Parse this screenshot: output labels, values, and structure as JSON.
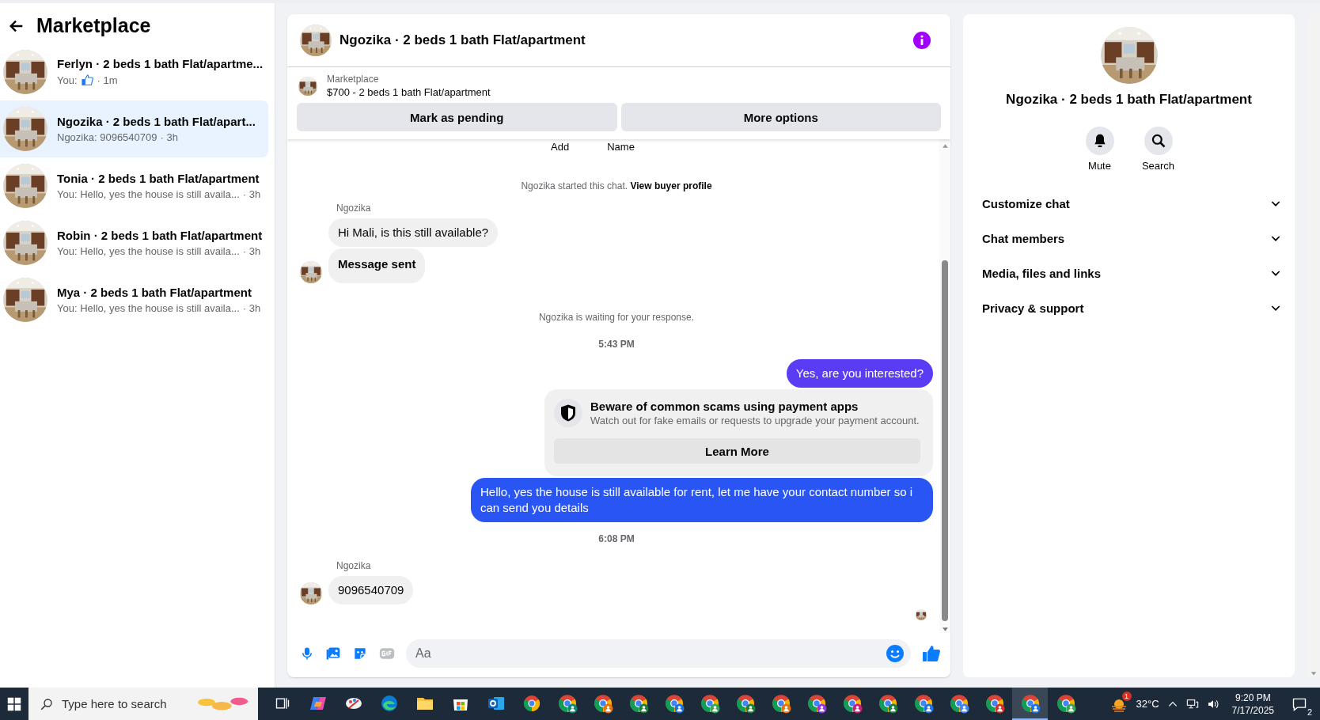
{
  "sidebar": {
    "title": "Marketplace",
    "conversations": [
      {
        "title": "Ferlyn · 2 beds 1 bath Flat/apartme...",
        "kind": "like",
        "preview": "You:",
        "time": "· 1m",
        "selected": false
      },
      {
        "title": "Ngozika · 2 beds 1 bath Flat/apart...",
        "kind": "text",
        "preview": "Ngozika: 9096540709",
        "time": "· 3h",
        "selected": true
      },
      {
        "title": "Tonia · 2 beds 1 bath Flat/apartment",
        "kind": "text",
        "preview": "You: Hello, yes the house is still availa...",
        "time": "· 3h",
        "selected": false
      },
      {
        "title": "Robin · 2 beds 1 bath Flat/apartment",
        "kind": "text",
        "preview": "You: Hello, yes the house is still availa...",
        "time": "· 3h",
        "selected": false
      },
      {
        "title": "Mya · 2 beds 1 bath Flat/apartment",
        "kind": "text",
        "preview": "You: Hello, yes the house is still availa...",
        "time": "· 3h",
        "selected": false
      }
    ]
  },
  "chat": {
    "title": "Ngozika · 2 beds 1 bath Flat/apartment",
    "listing": {
      "label": "Marketplace",
      "title": "$700 - 2 beds 1 bath Flat/apartment",
      "buttons": [
        "Mark as pending",
        "More options"
      ]
    },
    "messages": [
      {
        "kind": "cutoff",
        "texts": [
          "Add",
          "Name"
        ]
      },
      {
        "kind": "notice",
        "text": "Ngozika started this chat.",
        "link": "View buyer profile"
      },
      {
        "kind": "sender",
        "text": "Ngozika"
      },
      {
        "kind": "incoming",
        "text": "Hi Mali, is this still available?",
        "bold": false,
        "avatar": false
      },
      {
        "kind": "incoming",
        "text": "Message sent",
        "bold": true,
        "avatar": true
      },
      {
        "kind": "notice",
        "text": "Ngozika is waiting for your response."
      },
      {
        "kind": "timestamp",
        "text": "5:43 PM"
      },
      {
        "kind": "outgoing",
        "text": "Yes, are you interested?",
        "color": "#5b3cf5"
      },
      {
        "kind": "warning",
        "title": "Beware of common scams using payment apps",
        "text": "Watch out for fake emails or requests to upgrade your payment account.",
        "button": "Learn More"
      },
      {
        "kind": "outgoing",
        "text": "Hello, yes the house is still available for rent, let me have your contact number so i can send you details",
        "color": "#2a55f5"
      },
      {
        "kind": "timestamp",
        "text": "6:08 PM"
      },
      {
        "kind": "sender",
        "text": "Ngozika"
      },
      {
        "kind": "incoming",
        "text": "9096540709",
        "bold": false,
        "avatar": true
      },
      {
        "kind": "seen"
      }
    ],
    "composer": {
      "placeholder": "Aa"
    }
  },
  "info": {
    "title": "Ngozika · 2 beds 1 bath Flat/apartment",
    "actions": [
      {
        "kind": "bell",
        "label": "Mute"
      },
      {
        "kind": "search",
        "label": "Search"
      }
    ],
    "sections": [
      {
        "label": "Customize chat",
        "expanded": false
      },
      {
        "label": "Chat members",
        "expanded": false
      },
      {
        "label": "Media, files and links",
        "expanded": false
      },
      {
        "label": "Privacy & support",
        "expanded": false
      }
    ]
  },
  "taskbar": {
    "search_placeholder": "Type here to search",
    "apps": [
      {
        "kind": "task-view",
        "active": false
      },
      {
        "kind": "copilot",
        "active": false
      },
      {
        "kind": "paint",
        "active": false
      },
      {
        "kind": "edge",
        "active": false
      },
      {
        "kind": "folder",
        "active": false
      },
      {
        "kind": "store",
        "active": false
      },
      {
        "kind": "outlook",
        "active": false
      },
      {
        "kind": "chrome",
        "active": false
      },
      {
        "kind": "chrome-profile",
        "color": "#0b8a73",
        "active": false
      },
      {
        "kind": "chrome-profile",
        "color": "#e8710a",
        "active": false
      },
      {
        "kind": "chrome-profile",
        "color": "#188038",
        "active": false
      },
      {
        "kind": "chrome-profile",
        "color": "#1a73e8",
        "active": false
      },
      {
        "kind": "chrome-profile",
        "color": "#34a853",
        "active": false
      },
      {
        "kind": "chrome-profile",
        "color": "#188038",
        "active": false
      },
      {
        "kind": "chrome-profile",
        "color": "#e8710a",
        "active": false
      },
      {
        "kind": "chrome-profile",
        "color": "#9334e6",
        "active": false
      },
      {
        "kind": "chrome-profile",
        "color": "#d01884",
        "active": false
      },
      {
        "kind": "chrome-profile",
        "color": "#188038",
        "active": false
      },
      {
        "kind": "chrome-profile",
        "color": "#1a73e8",
        "active": false
      },
      {
        "kind": "chrome-profile",
        "color": "#4285f4",
        "active": false
      },
      {
        "kind": "chrome-profile",
        "color": "#d93025",
        "active": false
      },
      {
        "kind": "chrome-profile",
        "color": "#1a73e8",
        "active": true
      },
      {
        "kind": "chrome-profile",
        "color": "#34a853",
        "active": false
      }
    ],
    "weather_badge": "1",
    "temperature": "32°C",
    "time": "9:20 PM",
    "date": "7/17/2025",
    "notifications": "2"
  }
}
